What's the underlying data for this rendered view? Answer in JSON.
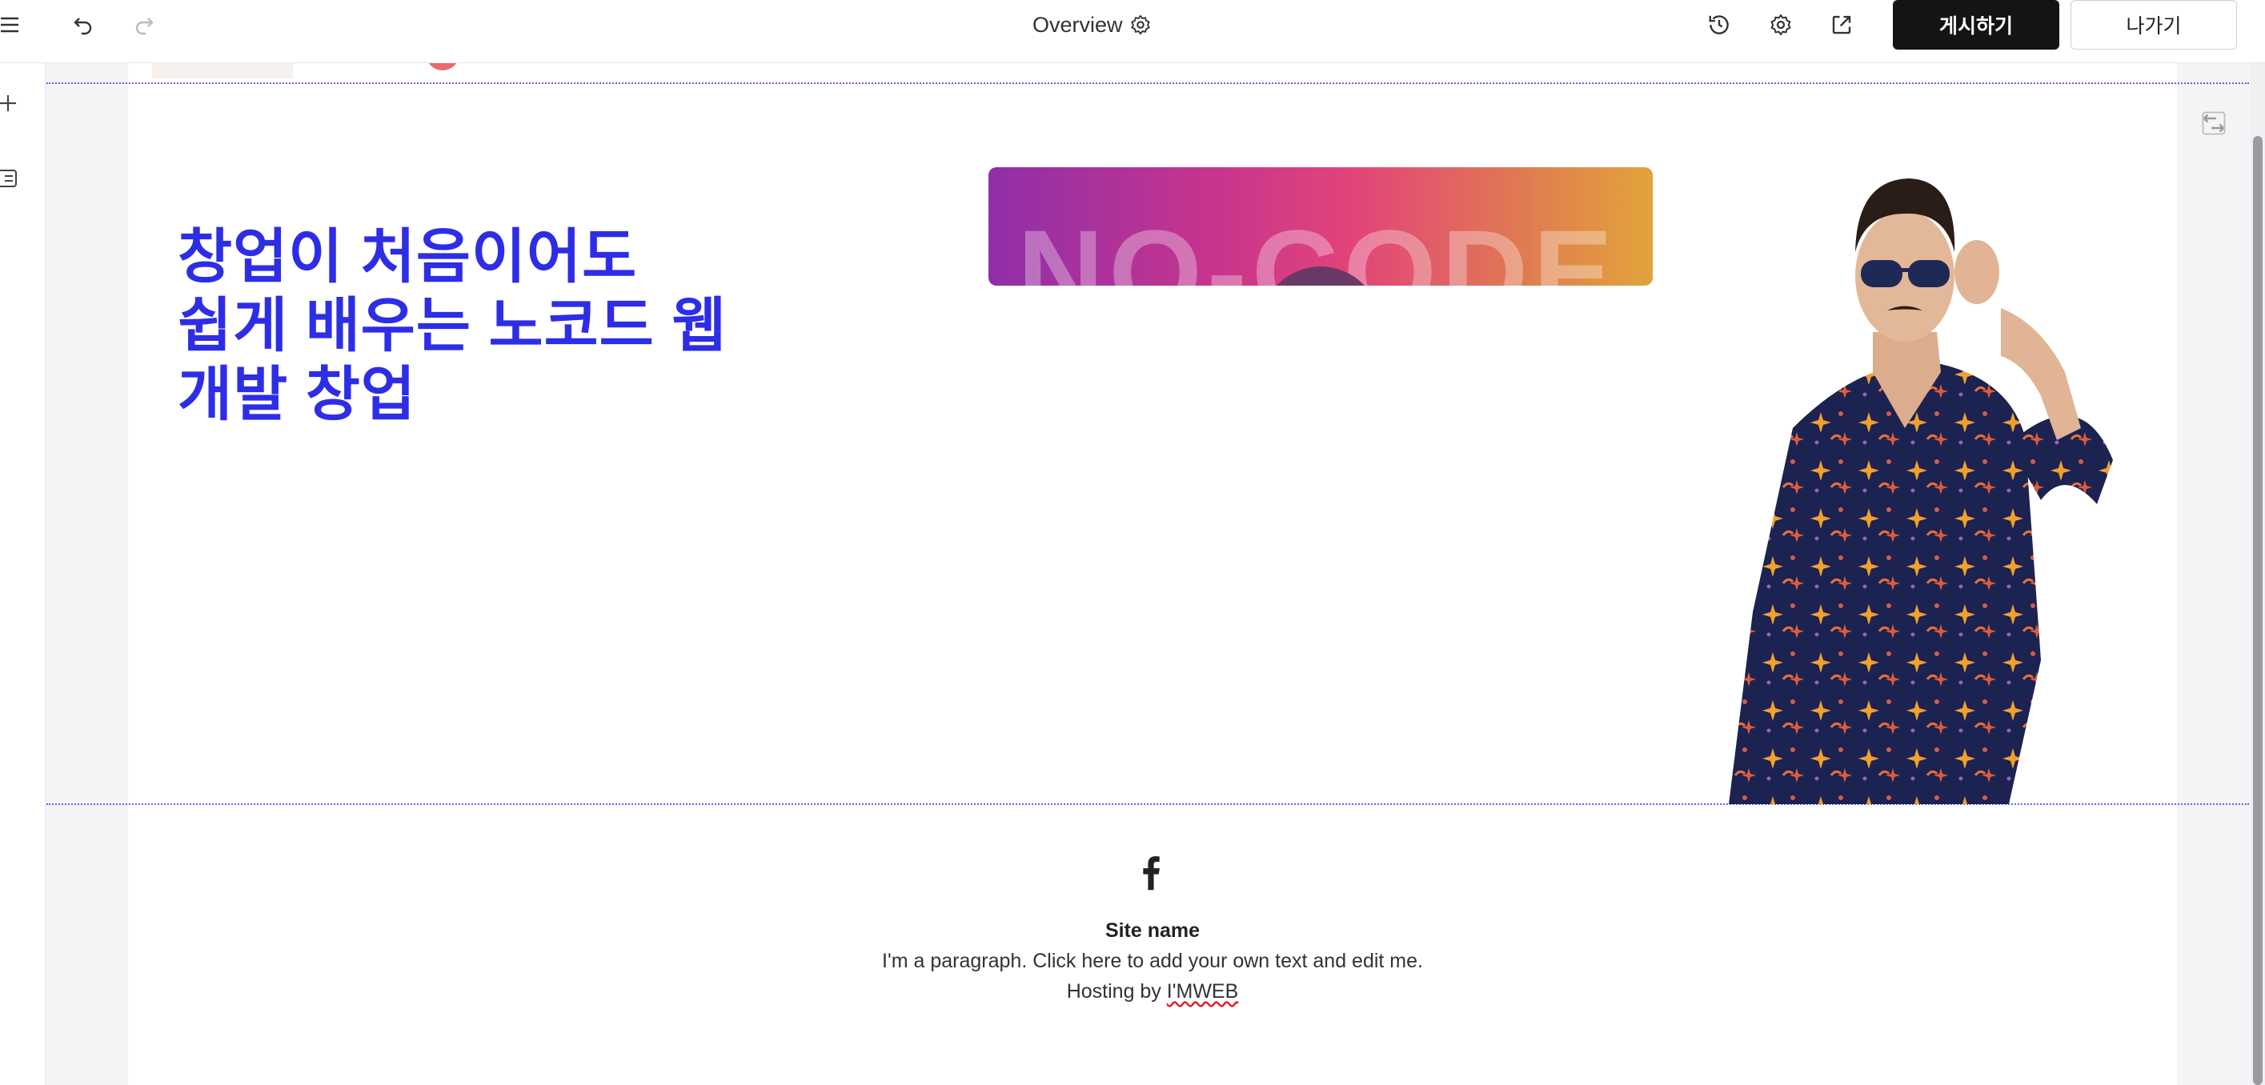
{
  "toolbar": {
    "title": "Overview",
    "publish_label": "게시하기",
    "exit_label": "나가기",
    "icons": [
      "menu-icon",
      "undo-icon",
      "redo-icon",
      "settings-icon",
      "history-icon",
      "gear-icon",
      "external-link-icon"
    ]
  },
  "leftbar": {
    "icons": [
      "plus-icon",
      "layers-icon"
    ]
  },
  "hero": {
    "headline_lines": [
      "창업이 처음이어도",
      "쉽게 배우는 노코드 웹",
      "개발 창업"
    ],
    "banner_text": "NO-CODE"
  },
  "footer": {
    "social_icon": "facebook-icon",
    "site_name": "Site name",
    "paragraph": "I'm a paragraph. Click here to add your own text and edit me.",
    "hosting_prefix": "Hosting by ",
    "hosting_brand": "I'MWEB"
  },
  "colors": {
    "headline": "#2e2de6",
    "publish_bg": "#141414",
    "guide_line": "#5b67e8"
  }
}
